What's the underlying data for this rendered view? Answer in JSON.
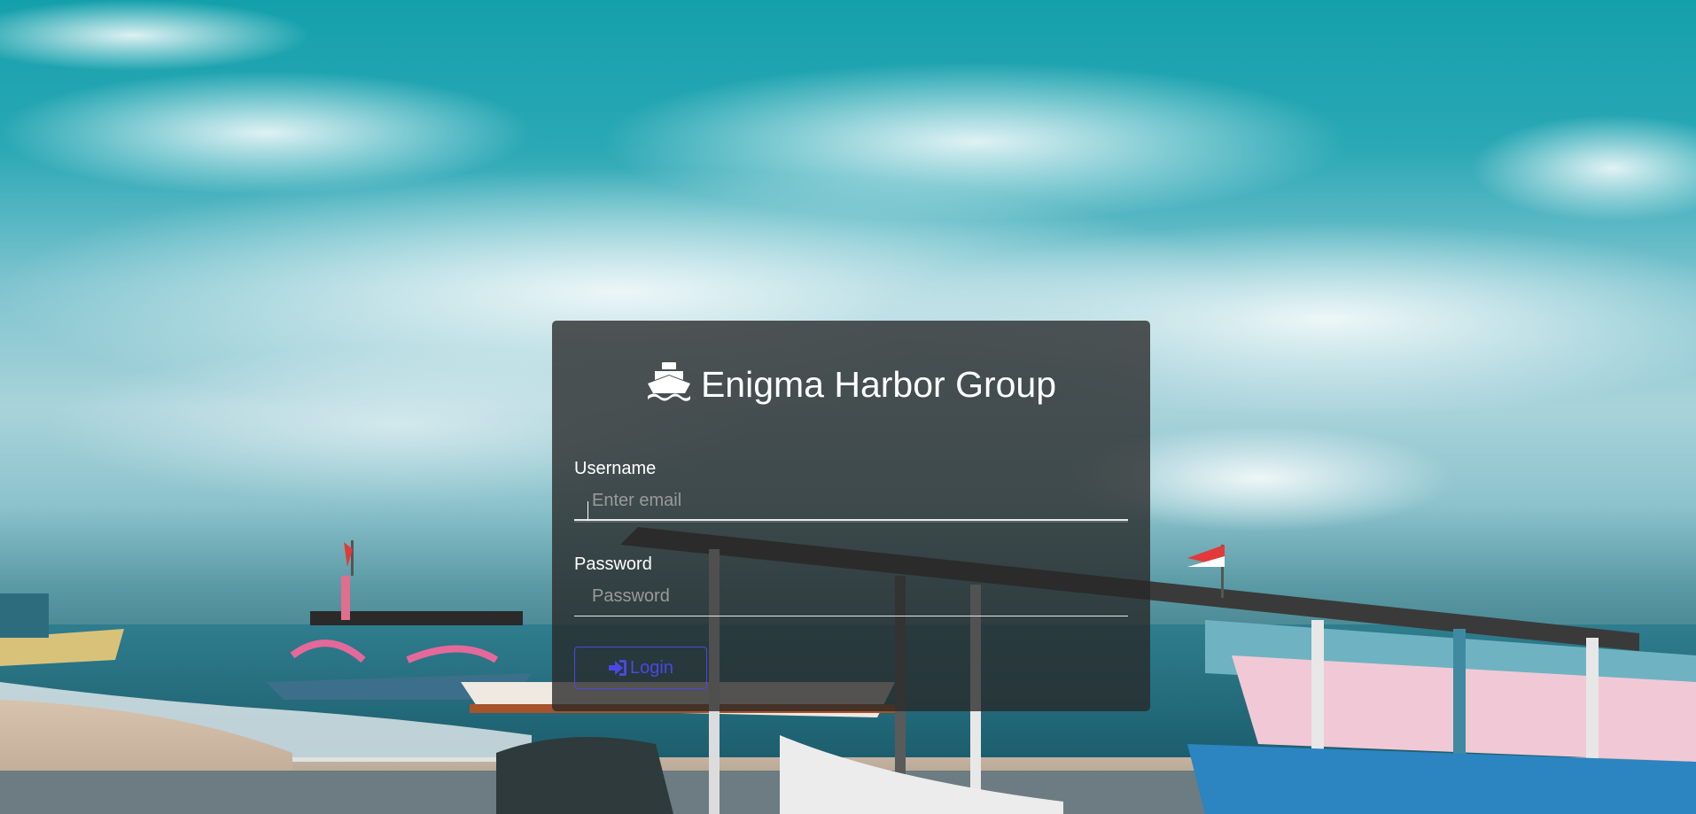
{
  "brand": {
    "title": "Enigma Harbor Group",
    "icon": "ship-icon"
  },
  "form": {
    "username_label": "Username",
    "username_placeholder": "Enter email",
    "username_value": "",
    "password_label": "Password",
    "password_placeholder": "Password",
    "password_value": "",
    "login_label": "Login",
    "login_icon": "sign-in-icon"
  },
  "colors": {
    "card_background": "rgba(40,40,40,0.78)",
    "login_button_accent": "#4b47e6",
    "text": "#ffffff",
    "placeholder": "#9a9a9a"
  }
}
